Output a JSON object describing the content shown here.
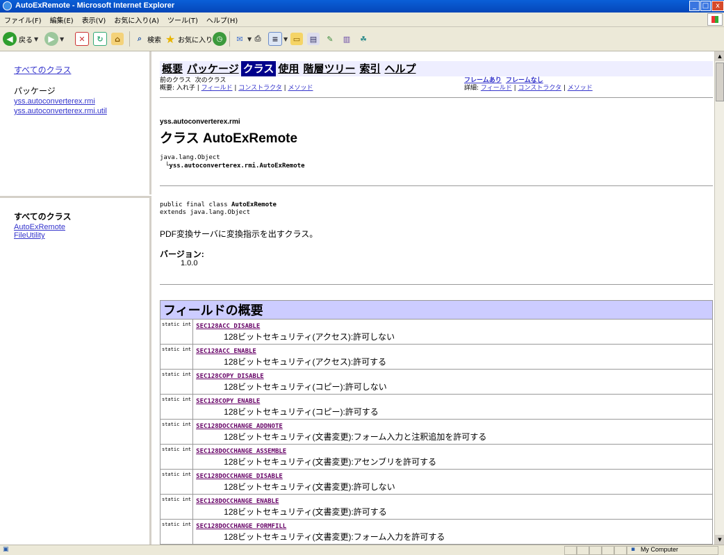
{
  "window": {
    "title": "AutoExRemote - Microsoft Internet Explorer",
    "min_label": "_",
    "max_label": "□",
    "close_label": "x"
  },
  "menu": [
    "ファイル(F)",
    "編集(E)",
    "表示(V)",
    "お気に入り(A)",
    "ツール(T)",
    "ヘルプ(H)"
  ],
  "toolbar": {
    "back_label": "戻る",
    "search_label": "検索",
    "favorites_label": "お気に入り"
  },
  "left_top": {
    "all_classes_link": "すべてのクラス",
    "packages_heading": "パッケージ",
    "packages": [
      "yss.autoconverterex.rmi",
      "yss.autoconverterex.rmi.util"
    ]
  },
  "left_bottom": {
    "heading": "すべてのクラス",
    "classes": [
      "AutoExRemote",
      "FileUtility"
    ]
  },
  "nav": {
    "items": [
      "概要",
      "パッケージ",
      "クラス",
      "使用",
      "階層ツリー",
      "索引",
      "ヘルプ"
    ],
    "active_index": 2,
    "prev_class": "前のクラス",
    "next_class": "次のクラス",
    "summary_prefix": "概要: 入れ子 | ",
    "summary_field": "フィールド",
    "summary_constructor": "コンストラクタ",
    "summary_method": "メソッド",
    "frames": "フレームあり",
    "noframes": "フレームなし",
    "detail_prefix": "詳細: ",
    "detail_field": "フィールド",
    "detail_constructor": "コンストラクタ",
    "detail_method": "メソッド",
    "sep": " | "
  },
  "class_info": {
    "package": "yss.autoconverterex.rmi",
    "title": "クラス AutoExRemote",
    "hierarchy_parent": "java.lang.Object",
    "hierarchy_child": "└yss.autoconverterex.rmi.AutoExRemote",
    "decl_prefix": "public final class ",
    "decl_name": "AutoExRemote",
    "decl_extends": "extends java.lang.Object",
    "description": "PDF変換サーバに変換指示を出すクラス。",
    "version_label": "バージョン:",
    "version_value": "1.0.0"
  },
  "field_summary": {
    "header": "フィールドの概要",
    "fields": [
      {
        "modifier": "static int",
        "name": "SEC128ACC_DISABLE",
        "desc": "128ビットセキュリティ(アクセス):許可しない"
      },
      {
        "modifier": "static int",
        "name": "SEC128ACC_ENABLE",
        "desc": "128ビットセキュリティ(アクセス):許可する"
      },
      {
        "modifier": "static int",
        "name": "SEC128COPY_DISABLE",
        "desc": "128ビットセキュリティ(コピー):許可しない"
      },
      {
        "modifier": "static int",
        "name": "SEC128COPY_ENABLE",
        "desc": "128ビットセキュリティ(コピー):許可する"
      },
      {
        "modifier": "static int",
        "name": "SEC128DOCCHANGE_ADDNOTE",
        "desc": "128ビットセキュリティ(文書変更):フォーム入力と注釈追加を許可する"
      },
      {
        "modifier": "static int",
        "name": "SEC128DOCCHANGE_ASSEMBLE",
        "desc": "128ビットセキュリティ(文書変更):アセンブリを許可する"
      },
      {
        "modifier": "static int",
        "name": "SEC128DOCCHANGE_DISABLE",
        "desc": "128ビットセキュリティ(文書変更):許可しない"
      },
      {
        "modifier": "static int",
        "name": "SEC128DOCCHANGE_ENABLE",
        "desc": "128ビットセキュリティ(文書変更):許可する"
      },
      {
        "modifier": "static int",
        "name": "SEC128DOCCHANGE_FORMFILL",
        "desc": "128ビットセキュリティ(文書変更):フォーム入力を許可する"
      }
    ]
  },
  "status": {
    "zone": "My Computer"
  }
}
